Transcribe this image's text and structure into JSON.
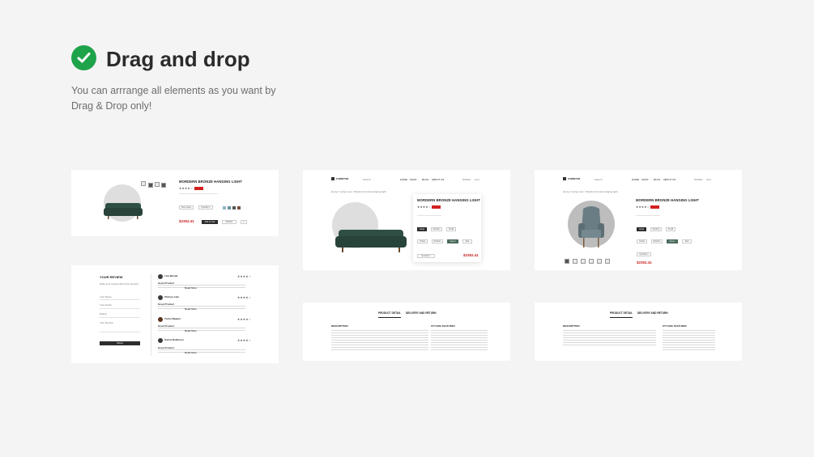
{
  "hero": {
    "title": "Drag and drop",
    "description": "You can arrrange all elements as you want by Drag & Drop only!",
    "icon": "check-circle-icon",
    "accent": "#1fa34a"
  },
  "product": {
    "title": "MORDERN BRONZE HANGING LIGHT",
    "price": "$2352.41",
    "rating": "★★★★☆",
    "sale_color": "#d32020",
    "add_to_cart": "Add to Cart",
    "sizes": [
      "Large",
      "Medium",
      "Small"
    ],
    "colors": [
      "Yellow",
      "Medium",
      "Green",
      "Red"
    ],
    "swatches": [
      "#8fb6c9",
      "#6b8fa0",
      "#555555",
      "#7a4f3c"
    ],
    "qty_label": "1",
    "selects": [
      "Size Large",
      "Quantity 1"
    ]
  },
  "header": {
    "brand": "FURNITUR",
    "search": "Search",
    "nav": [
      "HOME",
      "SHOP",
      "BLOG",
      "ABOUT US"
    ],
    "actions": [
      "Wishlist",
      "Cart"
    ],
    "breadcrumb": "Home / Living room / Mordern bronze hanging light"
  },
  "review": {
    "heading": "YOUR REVIEW",
    "subtitle": "Write your review about this product",
    "fields": [
      "Your Name",
      "Your Email",
      "Rating",
      "Your Review"
    ],
    "submit": "Submit",
    "stars": "★★★★☆",
    "items": [
      {
        "name": "Lisa Bernal",
        "title": "Great Product",
        "more": "Read More"
      },
      {
        "name": "Chrissy Lam",
        "title": "Great Product",
        "more": "Read More"
      },
      {
        "name": "Tomm Naquet",
        "title": "Great Product",
        "more": "Read More"
      },
      {
        "name": "Garret Robinson",
        "title": "Great Product",
        "more": "Read More"
      }
    ]
  },
  "details": {
    "tabs": [
      "PRODUCT DETAIL",
      "DELIVERY AND RETURN"
    ],
    "left_heading": "DESCRIPTION",
    "right_heading": "STYLING FEATURES"
  }
}
